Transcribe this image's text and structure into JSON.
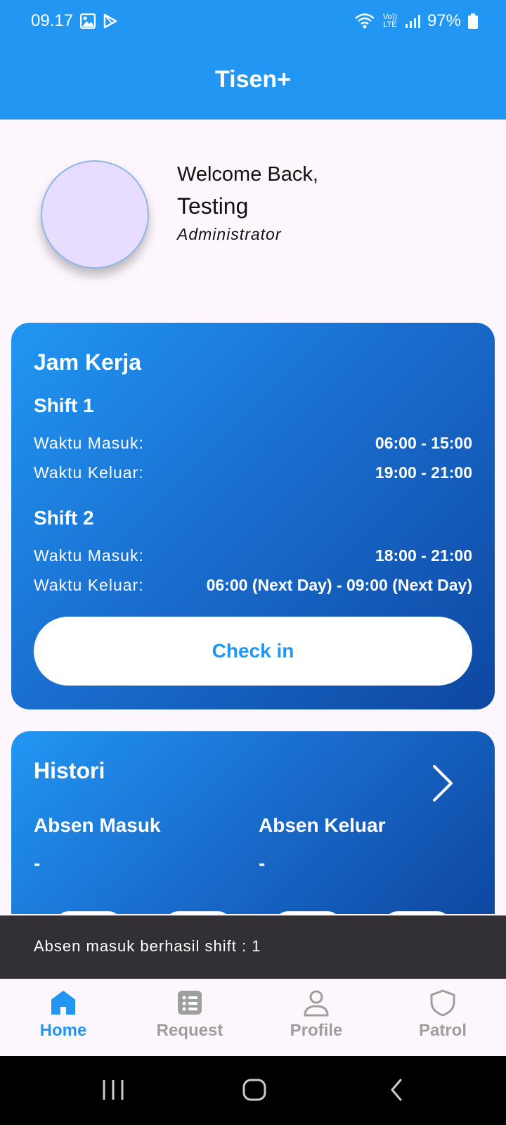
{
  "status_bar": {
    "time": "09.17",
    "battery": "97%",
    "volte": "Vo)) LTE"
  },
  "app_bar": {
    "title": "Tisen+"
  },
  "header": {
    "welcome": "Welcome Back,",
    "name": "Testing",
    "role": "Administrator"
  },
  "jam_kerja": {
    "title": "Jam Kerja",
    "shifts": [
      {
        "name": "Shift 1",
        "masuk_label": "Waktu Masuk:",
        "masuk_value": "06:00 - 15:00",
        "keluar_label": "Waktu Keluar:",
        "keluar_value": "19:00 - 21:00"
      },
      {
        "name": "Shift 2",
        "masuk_label": "Waktu Masuk:",
        "masuk_value": "18:00 - 21:00",
        "keluar_label": "Waktu Keluar:",
        "keluar_value": "06:00 (Next Day) - 09:00 (Next Day)"
      }
    ],
    "checkin_label": "Check in"
  },
  "histori": {
    "title": "Histori",
    "masuk_label": "Absen Masuk",
    "masuk_value": "-",
    "keluar_label": "Absen Keluar",
    "keluar_value": "-"
  },
  "snackbar": {
    "message": "Absen masuk berhasil shift : 1"
  },
  "bottom_nav": {
    "items": [
      {
        "label": "Home",
        "icon": "home-icon",
        "active": true
      },
      {
        "label": "Request",
        "icon": "list-icon",
        "active": false
      },
      {
        "label": "Profile",
        "icon": "person-icon",
        "active": false
      },
      {
        "label": "Patrol",
        "icon": "shield-icon",
        "active": false
      }
    ]
  },
  "colors": {
    "primary": "#2196f3",
    "card_dark": "#0d47a1",
    "snackbar": "#333035",
    "inactive": "#9e9e9e"
  }
}
